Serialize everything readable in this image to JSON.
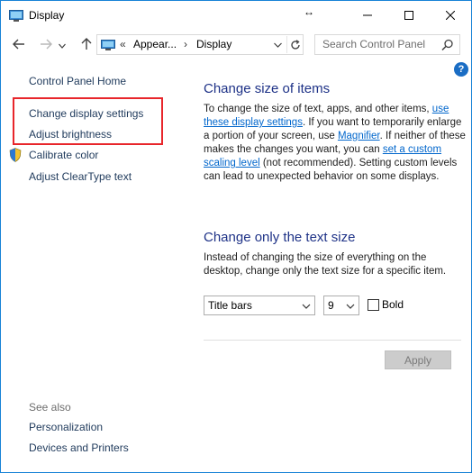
{
  "window": {
    "title": "Display",
    "resize_cursor_glyph": "↔"
  },
  "address": {
    "overflow_chevron": "«",
    "crumbs": [
      "Appear...",
      "Display"
    ],
    "separator": "›",
    "search_placeholder": "Search Control Panel"
  },
  "sidebar": {
    "home": "Control Panel Home",
    "items": [
      {
        "label": "Change display settings"
      },
      {
        "label": "Adjust brightness"
      },
      {
        "label": "Calibrate color"
      },
      {
        "label": "Adjust ClearType text"
      }
    ],
    "see_also": "See also",
    "see_also_items": [
      {
        "label": "Personalization"
      },
      {
        "label": "Devices and Printers"
      }
    ]
  },
  "main": {
    "size_heading": "Change size of items",
    "size_para": {
      "t1": "To change the size of text, apps, and other items, ",
      "link1": "use these display settings",
      "t2": ".  If you want to temporarily enlarge a portion of your screen, use ",
      "link2": "Magnifier",
      "t3": ".  If neither of these makes the changes you want, you can ",
      "link3": "set a custom scaling level",
      "t4": " (not recommended).  Setting custom levels can lead to unexpected behavior on some displays."
    },
    "text_heading": "Change only the text size",
    "text_para": "Instead of changing the size of everything on the desktop, change only the text size for a specific item.",
    "item_select": "Title bars",
    "size_select": "9",
    "bold_label": "Bold",
    "bold_checked": false,
    "apply_label": "Apply"
  },
  "colors": {
    "heading": "#1e3287",
    "link": "#0066cc",
    "highlight": "#e8262b",
    "window_border": "#1883d7"
  },
  "icons": [
    "display-icon",
    "back-arrow-icon",
    "forward-arrow-icon",
    "chevron-down-icon",
    "up-arrow-icon",
    "refresh-icon",
    "search-icon",
    "help-icon",
    "shield-icon",
    "minimize-icon",
    "maximize-icon",
    "close-icon"
  ]
}
